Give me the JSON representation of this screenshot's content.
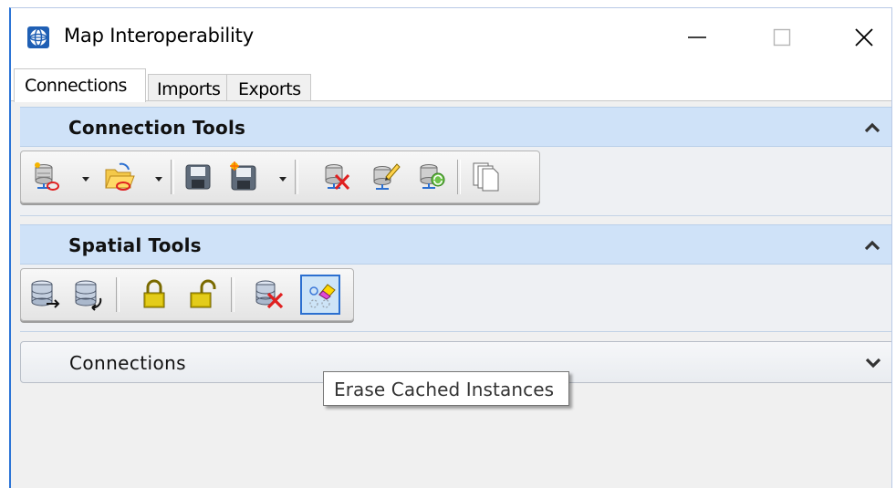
{
  "window": {
    "title": "Map Interoperability",
    "app_icon": "globe-icon",
    "controls": [
      "minimize-icon",
      "maximize-icon",
      "close-icon"
    ]
  },
  "tabs": [
    {
      "label": "Connections",
      "active": true
    },
    {
      "label": "Imports",
      "active": false
    },
    {
      "label": "Exports",
      "active": false
    }
  ],
  "connection_tools": {
    "title": "Connection Tools",
    "collapse_icon": "chevron-up-icon",
    "buttons": [
      {
        "icon": "new-connection-icon",
        "has_dropdown": true
      },
      {
        "icon": "open-connection-icon",
        "has_dropdown": true
      },
      {
        "icon": "save-icon",
        "has_dropdown": false
      },
      {
        "icon": "save-new-icon",
        "has_dropdown": true
      },
      {
        "icon": "delete-connection-icon",
        "has_dropdown": false
      },
      {
        "icon": "edit-connection-icon",
        "has_dropdown": false
      },
      {
        "icon": "refresh-connection-icon",
        "has_dropdown": false
      },
      {
        "icon": "copy-icon",
        "has_dropdown": false
      }
    ]
  },
  "spatial_tools": {
    "title": "Spatial Tools",
    "collapse_icon": "chevron-up-icon",
    "buttons": [
      {
        "icon": "database-export-icon"
      },
      {
        "icon": "database-import-icon"
      },
      {
        "icon": "lock-icon"
      },
      {
        "icon": "unlock-icon"
      },
      {
        "icon": "database-delete-icon"
      },
      {
        "icon": "erase-cache-icon",
        "active": true
      }
    ]
  },
  "connections_section": {
    "title": "Connections",
    "expand_icon": "chevron-down-icon"
  },
  "tooltip": {
    "text": "Erase Cached Instances"
  },
  "colors": {
    "accent": "#2b74d6",
    "header_bg": "#cfe2f8",
    "panel_bg": "#f0f0f0"
  }
}
